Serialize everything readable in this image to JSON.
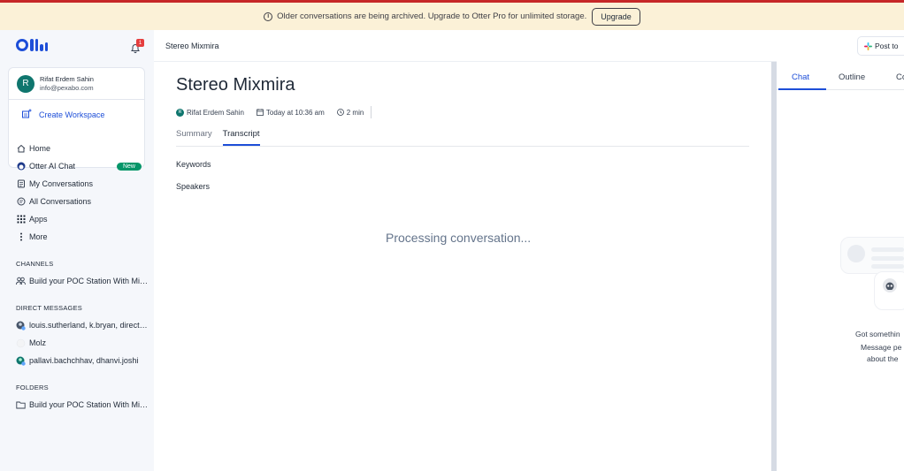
{
  "banner": {
    "message": "Older conversations are being archived. Upgrade to Otter Pro for unlimited storage.",
    "upgrade_label": "Upgrade",
    "info_glyph": "i"
  },
  "sidebar": {
    "notification_count": "1",
    "account": {
      "avatar_letter": "R",
      "name": "Rifat Erdem Sahin",
      "email": "info@pexabo.com",
      "create_workspace": "Create Workspace"
    },
    "nav": [
      {
        "label": "Home",
        "icon": "home-icon"
      },
      {
        "label": "Otter AI Chat",
        "icon": "otter-chat-icon",
        "badge": "New"
      },
      {
        "label": "My Conversations",
        "icon": "document-icon"
      },
      {
        "label": "All Conversations",
        "icon": "conversations-icon"
      },
      {
        "label": "Apps",
        "icon": "grid-icon"
      },
      {
        "label": "More",
        "icon": "more-vertical-icon"
      }
    ],
    "channels_label": "CHANNELS",
    "channels": [
      {
        "label": "Build your POC Station With Mixmira",
        "icon": "group-icon"
      }
    ],
    "dm_label": "DIRECT MESSAGES",
    "direct_messages": [
      {
        "label": "louis.sutherland, k.bryan, directors",
        "icon": "avatar-group-icon"
      },
      {
        "label": "Molz",
        "icon": "avatar-icon"
      },
      {
        "label": "pallavi.bachchhav, dhanvi.joshi",
        "icon": "avatar-group-icon"
      }
    ],
    "folders_label": "FOLDERS",
    "folders": [
      {
        "label": "Build your POC Station With Mixmira",
        "icon": "folder-icon"
      }
    ]
  },
  "header": {
    "breadcrumb_title": "Stereo Mixmira",
    "post_label": "Post to"
  },
  "conversation": {
    "title": "Stereo Mixmira",
    "author_initial": "R",
    "author": "Rifat Erdem Sahin",
    "date": "Today at 10:36 am",
    "duration": "2 min",
    "tabs": [
      {
        "label": "Summary"
      },
      {
        "label": "Transcript"
      }
    ],
    "active_tab": "Transcript",
    "keywords_label": "Keywords",
    "speakers_label": "Speakers",
    "processing_message": "Processing conversation..."
  },
  "right_panel": {
    "tabs": [
      {
        "label": "Chat"
      },
      {
        "label": "Outline"
      },
      {
        "label": "Co"
      }
    ],
    "active_tab": "Chat",
    "empty_line1": "Got somethin",
    "empty_line2": "Message pe",
    "empty_line3": "about the"
  },
  "colors": {
    "accent": "#1d4ed8",
    "banner_bg": "#fbf1d7",
    "top_line": "#c62828",
    "new_badge": "#059669",
    "avatar": "#0f766e"
  }
}
